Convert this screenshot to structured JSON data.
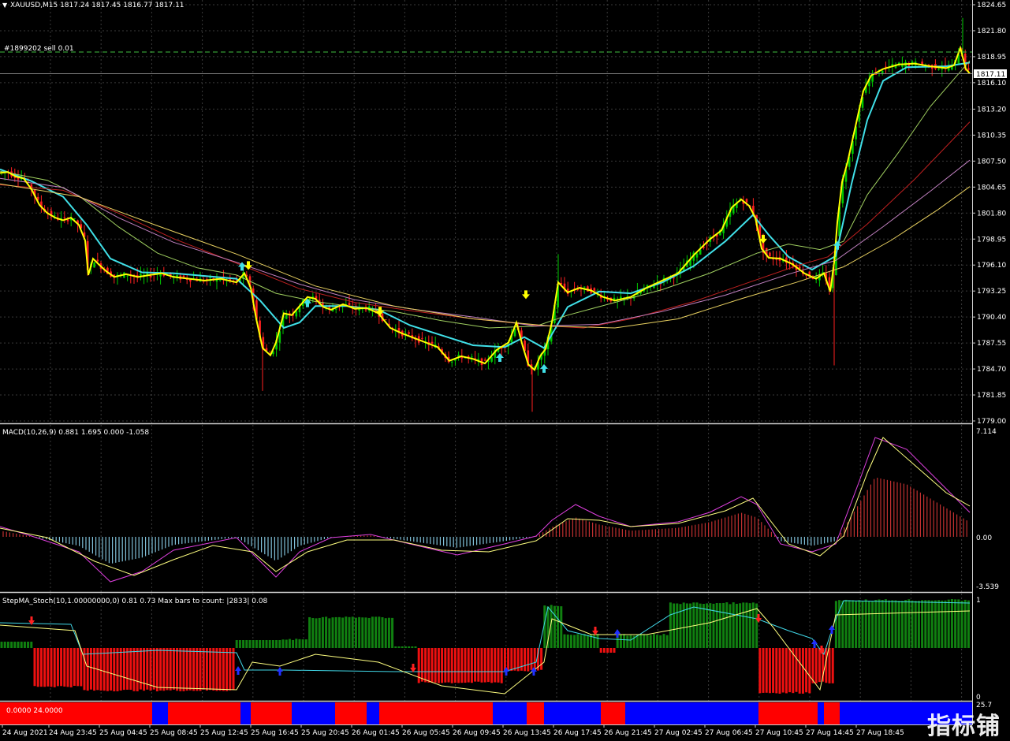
{
  "main_panel": {
    "header": "XAUUSD,M15  1817.24 1817.45 1816.77 1817.11",
    "order_label": "#1899202 sell 0.01",
    "current_price": "1817.11",
    "price_ticks": [
      "1824.65",
      "1821.80",
      "1818.95",
      "1816.10",
      "1813.20",
      "1810.35",
      "1807.50",
      "1804.65",
      "1801.80",
      "1798.95",
      "1796.10",
      "1793.25",
      "1790.40",
      "1787.55",
      "1784.70",
      "1781.85",
      "1779.00"
    ]
  },
  "macd_panel": {
    "header": "MACD(10,26,9) 0.881 1.695 0.000 -1.058",
    "ticks": [
      "7.114",
      "0.00",
      "-3.539"
    ]
  },
  "stoch_panel": {
    "header": "StepMA_Stoch(10,1.00000000,0) 0.81 0.73  Max bars to count: |2833|  0.08",
    "ticks": [
      "1",
      "0"
    ]
  },
  "bottom_bar": {
    "label": "0.0000 24.0000",
    "tick": "25.7"
  },
  "time_axis": [
    "24 Aug 2021",
    "24 Aug 23:45",
    "25 Aug 04:45",
    "25 Aug 08:45",
    "25 Aug 12:45",
    "25 Aug 16:45",
    "25 Aug 20:45",
    "26 Aug 01:45",
    "26 Aug 05:45",
    "26 Aug 09:45",
    "26 Aug 13:45",
    "26 Aug 17:45",
    "26 Aug 21:45",
    "27 Aug 02:45",
    "27 Aug 06:45",
    "27 Aug 10:45",
    "27 Aug 14:45",
    "27 Aug 18:45"
  ],
  "watermark": "指标铺",
  "colors": {
    "bull": "#00c800",
    "bear": "#ff2020",
    "ma_fast": "#ffff00",
    "ma_cyan": "#40e0e8",
    "ma_red": "#c02020",
    "ma_violet": "#c080c0",
    "ma_gold": "#e8d060",
    "ma_lime": "#a0d060",
    "grid": "#3a3a3a",
    "bar_red": "#ff0000",
    "bar_blue": "#0000ff"
  },
  "chart_data": {
    "type": "line",
    "title": "XAUUSD,M15",
    "ylim": [
      1779.0,
      1824.65
    ],
    "close_path": [
      [
        0,
        1806.2
      ],
      [
        10,
        1806.3
      ],
      [
        20,
        1805.8
      ],
      [
        30,
        1805.6
      ],
      [
        40,
        1804.4
      ],
      [
        50,
        1802.7
      ],
      [
        60,
        1801.8
      ],
      [
        70,
        1801.3
      ],
      [
        80,
        1801.0
      ],
      [
        90,
        1801.3
      ],
      [
        100,
        1800.5
      ],
      [
        108,
        1798.8
      ],
      [
        112,
        1795.0
      ],
      [
        118,
        1796.8
      ],
      [
        125,
        1796.2
      ],
      [
        135,
        1795.4
      ],
      [
        145,
        1794.8
      ],
      [
        160,
        1795.1
      ],
      [
        175,
        1794.8
      ],
      [
        190,
        1795.0
      ],
      [
        205,
        1795.2
      ],
      [
        220,
        1794.8
      ],
      [
        240,
        1794.6
      ],
      [
        260,
        1794.4
      ],
      [
        280,
        1794.6
      ],
      [
        300,
        1794.2
      ],
      [
        310,
        1795.2
      ],
      [
        318,
        1793.6
      ],
      [
        325,
        1790.2
      ],
      [
        333,
        1787.0
      ],
      [
        343,
        1786.2
      ],
      [
        350,
        1787.6
      ],
      [
        360,
        1790.8
      ],
      [
        370,
        1790.6
      ],
      [
        380,
        1791.6
      ],
      [
        390,
        1792.6
      ],
      [
        400,
        1792.4
      ],
      [
        410,
        1791.5
      ],
      [
        420,
        1791.2
      ],
      [
        435,
        1791.8
      ],
      [
        450,
        1791.3
      ],
      [
        465,
        1791.4
      ],
      [
        480,
        1790.8
      ],
      [
        495,
        1789.2
      ],
      [
        510,
        1788.6
      ],
      [
        525,
        1788.1
      ],
      [
        540,
        1787.6
      ],
      [
        555,
        1787.1
      ],
      [
        570,
        1785.6
      ],
      [
        585,
        1786.1
      ],
      [
        600,
        1785.8
      ],
      [
        615,
        1785.3
      ],
      [
        630,
        1786.8
      ],
      [
        645,
        1787.6
      ],
      [
        655,
        1789.8
      ],
      [
        663,
        1787.2
      ],
      [
        670,
        1785.2
      ],
      [
        678,
        1784.6
      ],
      [
        685,
        1786.1
      ],
      [
        692,
        1786.9
      ],
      [
        700,
        1789.8
      ],
      [
        708,
        1794.2
      ],
      [
        720,
        1793.1
      ],
      [
        735,
        1793.6
      ],
      [
        750,
        1793.3
      ],
      [
        765,
        1792.6
      ],
      [
        780,
        1792.2
      ],
      [
        800,
        1792.6
      ],
      [
        820,
        1793.6
      ],
      [
        840,
        1794.4
      ],
      [
        860,
        1795.2
      ],
      [
        880,
        1797.2
      ],
      [
        900,
        1798.9
      ],
      [
        915,
        1799.9
      ],
      [
        928,
        1802.4
      ],
      [
        940,
        1803.3
      ],
      [
        950,
        1802.6
      ],
      [
        958,
        1801.3
      ],
      [
        966,
        1797.9
      ],
      [
        975,
        1796.9
      ],
      [
        990,
        1796.8
      ],
      [
        1005,
        1796.2
      ],
      [
        1020,
        1795.2
      ],
      [
        1035,
        1794.6
      ],
      [
        1045,
        1795.2
      ],
      [
        1053,
        1793.2
      ],
      [
        1058,
        1796.4
      ],
      [
        1062,
        1800.8
      ],
      [
        1068,
        1805.2
      ],
      [
        1075,
        1807.4
      ],
      [
        1085,
        1811.3
      ],
      [
        1095,
        1815.2
      ],
      [
        1105,
        1816.9
      ],
      [
        1120,
        1817.6
      ],
      [
        1140,
        1818.1
      ],
      [
        1160,
        1818.2
      ],
      [
        1180,
        1817.9
      ],
      [
        1200,
        1817.7
      ],
      [
        1210,
        1818.0
      ],
      [
        1218,
        1819.9
      ],
      [
        1225,
        1817.6
      ],
      [
        1230,
        1817.11
      ]
    ],
    "series": [
      {
        "color": "#40e0e8",
        "values": [
          [
            0,
            1806.6
          ],
          [
            40,
            1805.3
          ],
          [
            80,
            1803.6
          ],
          [
            110,
            1800.5
          ],
          [
            140,
            1796.8
          ],
          [
            180,
            1795.3
          ],
          [
            220,
            1795.2
          ],
          [
            260,
            1794.9
          ],
          [
            300,
            1794.6
          ],
          [
            330,
            1792.2
          ],
          [
            360,
            1789.2
          ],
          [
            380,
            1789.8
          ],
          [
            400,
            1791.6
          ],
          [
            440,
            1791.6
          ],
          [
            480,
            1791.2
          ],
          [
            520,
            1789.5
          ],
          [
            560,
            1788.4
          ],
          [
            600,
            1787.3
          ],
          [
            640,
            1787.1
          ],
          [
            665,
            1788.2
          ],
          [
            690,
            1787.0
          ],
          [
            720,
            1791.5
          ],
          [
            760,
            1793.2
          ],
          [
            800,
            1793.0
          ],
          [
            840,
            1794.2
          ],
          [
            880,
            1796.0
          ],
          [
            920,
            1798.7
          ],
          [
            955,
            1801.6
          ],
          [
            975,
            1799.4
          ],
          [
            1000,
            1797.0
          ],
          [
            1030,
            1795.6
          ],
          [
            1060,
            1797.1
          ],
          [
            1080,
            1805.0
          ],
          [
            1100,
            1812.0
          ],
          [
            1120,
            1816.3
          ],
          [
            1150,
            1817.8
          ],
          [
            1200,
            1817.9
          ],
          [
            1230,
            1818.3
          ]
        ]
      },
      {
        "color": "#a0d060",
        "values": [
          [
            0,
            1806.4
          ],
          [
            60,
            1805.4
          ],
          [
            100,
            1803.7
          ],
          [
            150,
            1800.3
          ],
          [
            200,
            1797.4
          ],
          [
            250,
            1795.8
          ],
          [
            300,
            1795.0
          ],
          [
            350,
            1793.0
          ],
          [
            400,
            1792.1
          ],
          [
            450,
            1791.5
          ],
          [
            500,
            1791.0
          ],
          [
            560,
            1790.0
          ],
          [
            620,
            1789.2
          ],
          [
            680,
            1789.4
          ],
          [
            720,
            1790.6
          ],
          [
            780,
            1792.0
          ],
          [
            840,
            1793.4
          ],
          [
            900,
            1795.2
          ],
          [
            960,
            1797.4
          ],
          [
            1000,
            1798.4
          ],
          [
            1040,
            1797.8
          ],
          [
            1070,
            1798.7
          ],
          [
            1100,
            1803.8
          ],
          [
            1140,
            1808.5
          ],
          [
            1180,
            1813.5
          ],
          [
            1230,
            1818.5
          ]
        ]
      },
      {
        "color": "#c02020",
        "values": [
          [
            0,
            1804.9
          ],
          [
            80,
            1804.3
          ],
          [
            150,
            1801.8
          ],
          [
            220,
            1799.0
          ],
          [
            300,
            1796.3
          ],
          [
            380,
            1793.5
          ],
          [
            450,
            1792.0
          ],
          [
            520,
            1791.1
          ],
          [
            600,
            1790.2
          ],
          [
            680,
            1789.5
          ],
          [
            740,
            1789.2
          ],
          [
            800,
            1790.2
          ],
          [
            880,
            1792.1
          ],
          [
            950,
            1794.2
          ],
          [
            1010,
            1796.0
          ],
          [
            1050,
            1797.0
          ],
          [
            1100,
            1800.6
          ],
          [
            1160,
            1805.5
          ],
          [
            1230,
            1811.8
          ]
        ]
      },
      {
        "color": "#c080c0",
        "values": [
          [
            0,
            1805.6
          ],
          [
            80,
            1804.6
          ],
          [
            150,
            1801.3
          ],
          [
            220,
            1798.6
          ],
          [
            300,
            1796.4
          ],
          [
            380,
            1794.0
          ],
          [
            450,
            1792.3
          ],
          [
            520,
            1791.3
          ],
          [
            600,
            1790.4
          ],
          [
            680,
            1789.4
          ],
          [
            760,
            1789.6
          ],
          [
            840,
            1791.0
          ],
          [
            920,
            1792.8
          ],
          [
            1000,
            1795.1
          ],
          [
            1060,
            1796.6
          ],
          [
            1120,
            1800.3
          ],
          [
            1180,
            1804.2
          ],
          [
            1230,
            1807.6
          ]
        ]
      },
      {
        "color": "#e8d060",
        "values": [
          [
            0,
            1805.0
          ],
          [
            100,
            1803.6
          ],
          [
            200,
            1800.4
          ],
          [
            300,
            1797.3
          ],
          [
            400,
            1793.8
          ],
          [
            500,
            1791.6
          ],
          [
            600,
            1790.2
          ],
          [
            700,
            1789.4
          ],
          [
            780,
            1789.2
          ],
          [
            860,
            1790.2
          ],
          [
            940,
            1792.4
          ],
          [
            1010,
            1794.2
          ],
          [
            1070,
            1795.9
          ],
          [
            1130,
            1798.8
          ],
          [
            1190,
            1802.2
          ],
          [
            1230,
            1804.7
          ]
        ]
      }
    ]
  }
}
